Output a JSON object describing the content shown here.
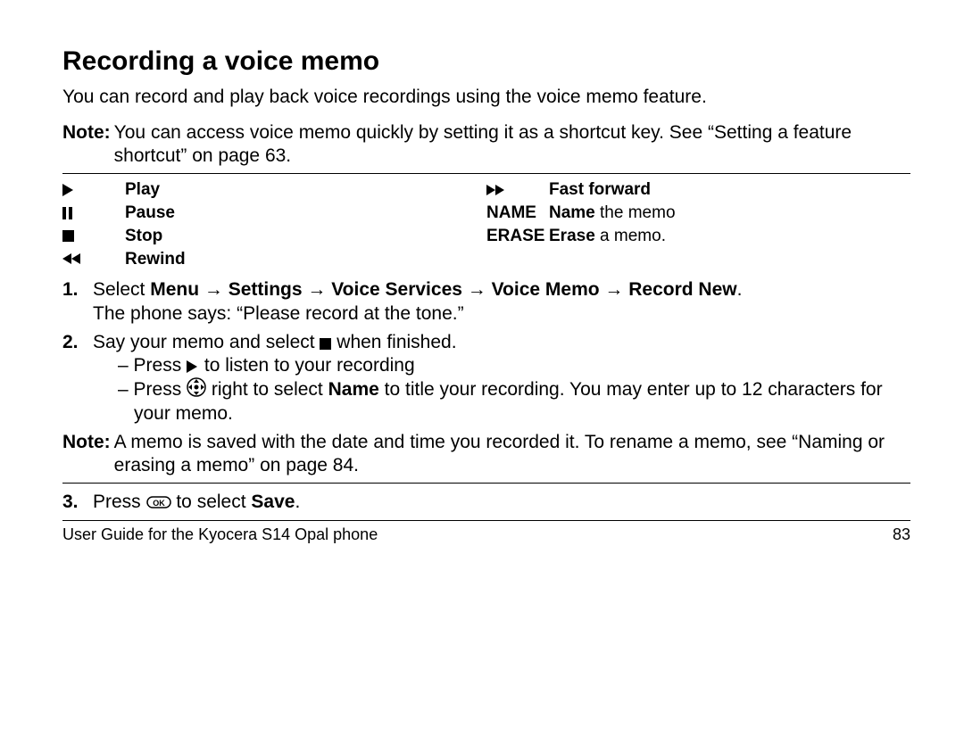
{
  "title": "Recording a voice memo",
  "intro": "You can record and play back voice recordings using the voice memo feature.",
  "note1_label": "Note:",
  "note1_body": "You can access voice memo quickly by setting it as a shortcut key. See “Setting a feature shortcut” on page 63.",
  "legend": {
    "play": "Play",
    "pause": "Pause",
    "stop": "Stop",
    "rewind": "Rewind",
    "ff": "Fast forward",
    "name_key": "NAME",
    "name_text_bold": "Name",
    "name_text_rest": " the memo",
    "erase_key": "ERASE",
    "erase_text_bold": "Erase",
    "erase_text_rest": " a memo."
  },
  "steps": {
    "s1_num": "1.",
    "s1_pre": "Select ",
    "s1_path": "Menu → Settings → Voice Services → Voice Memo → Record New",
    "s1_post": ".",
    "s1_line2": "The phone says: “Please record at the tone.”",
    "s2_num": "2.",
    "s2_pre": "Say your memo and select ",
    "s2_post": " when finished.",
    "s2_sub1_pre": "–   Press ",
    "s2_sub1_post": " to listen to your recording",
    "s2_sub2_pre": "–   Press ",
    "s2_sub2_mid": " right to select ",
    "s2_sub2_bold": "Name",
    "s2_sub2_post": " to title your recording. You may enter up to 12 characters for your memo.",
    "s3_num": "3.",
    "s3_pre": "Press ",
    "s3_mid": " to select ",
    "s3_bold": "Save",
    "s3_post": "."
  },
  "note2_label": "Note:",
  "note2_body": "A memo is saved with the date and time you recorded it. To rename a memo, see “Naming or erasing a memo” on page 84.",
  "footer_left": "User Guide for the Kyocera S14 Opal phone",
  "footer_right": "83"
}
